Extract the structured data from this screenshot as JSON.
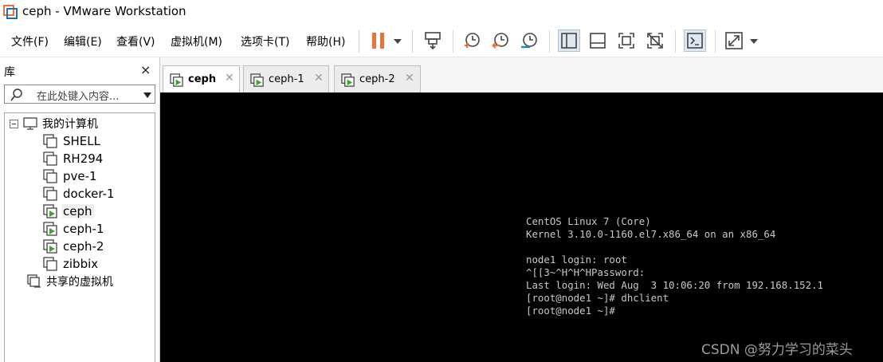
{
  "window": {
    "title": "ceph - VMware Workstation"
  },
  "menu": {
    "items": [
      "文件(F)",
      "编辑(E)",
      "查看(V)",
      "虚拟机(M)",
      "选项卡(T)",
      "帮助(H)"
    ]
  },
  "toolbar": {
    "buttons": [
      "pause-icon",
      "send-ctrl-alt-del-icon",
      "snapshot-icon",
      "revert-snapshot-icon",
      "snapshot-manager-icon",
      "library-view-icon",
      "thumbnail-bar-icon",
      "full-screen-icon",
      "unity-icon",
      "console-view-icon",
      "stretch-icon"
    ],
    "accent": "#e8743b"
  },
  "library": {
    "title": "库",
    "close": "×",
    "search_placeholder": "在此处键入内容...",
    "root": "我的计算机",
    "vms": [
      "SHELL",
      "RH294",
      "pve-1",
      "docker-1",
      "ceph",
      "ceph-1",
      "ceph-2",
      "zibbix"
    ],
    "running": [
      "ceph",
      "ceph-1",
      "ceph-2"
    ],
    "selected": "ceph",
    "shared": "共享的虚拟机"
  },
  "tabs": [
    {
      "label": "ceph",
      "active": true
    },
    {
      "label": "ceph-1",
      "active": false
    },
    {
      "label": "ceph-2",
      "active": false
    }
  ],
  "console": {
    "lines": [
      "CentOS Linux 7 (Core)",
      "Kernel 3.10.0-1160.el7.x86_64 on an x86_64",
      "",
      "node1 login: root",
      "^[[3~^H^H^HPassword:",
      "Last login: Wed Aug  3 10:06:20 from 192.168.152.1",
      "[root@node1 ~]# dhclient",
      "[root@node1 ~]#"
    ]
  },
  "watermark": "CSDN @努力学习的菜头"
}
